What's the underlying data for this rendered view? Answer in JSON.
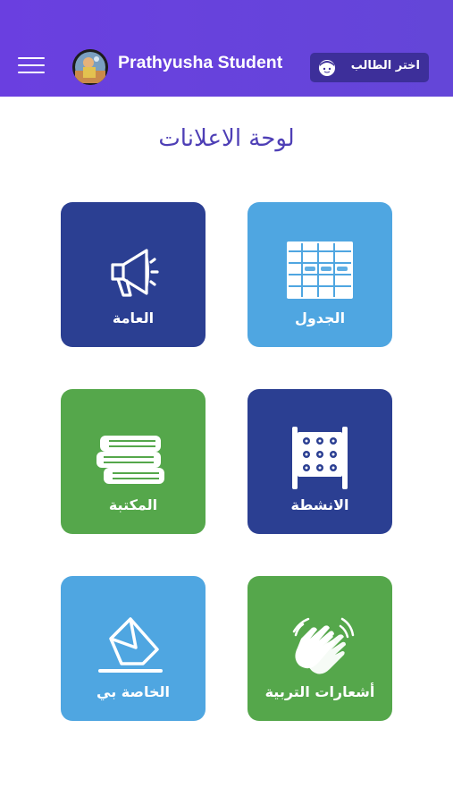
{
  "header": {
    "user_name": "Prathyusha Student",
    "select_student_label": "اختر الطالب"
  },
  "page": {
    "title": "لوحة الاعلانات"
  },
  "tiles": [
    {
      "label": "العامة",
      "icon": "megaphone-icon",
      "color": "#2b3f92"
    },
    {
      "label": "الجدول",
      "icon": "timetable-icon",
      "color": "#4fa6e1"
    },
    {
      "label": "المكتبة",
      "icon": "books-icon",
      "color": "#55a74b"
    },
    {
      "label": "الانشطة",
      "icon": "abacus-icon",
      "color": "#2b3f92"
    },
    {
      "label": "الخاصة بي",
      "icon": "envelope-icon",
      "color": "#4fa6e1"
    },
    {
      "label": "أشعارات التربية",
      "icon": "clapping-hands-icon",
      "color": "#55a74b"
    }
  ]
}
